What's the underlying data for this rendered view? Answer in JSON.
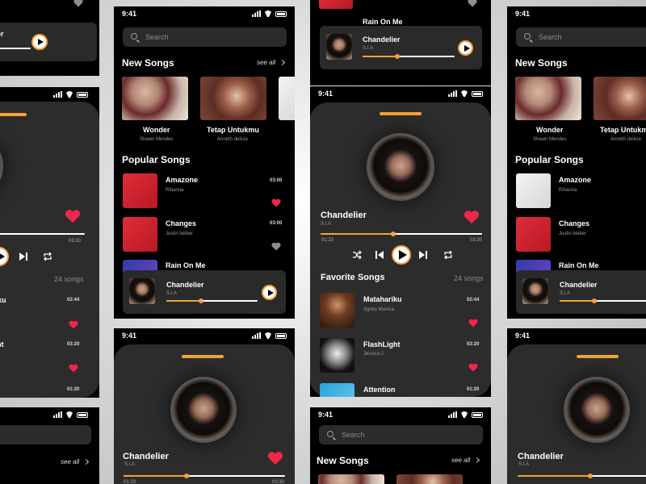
{
  "status": {
    "time": "9:41"
  },
  "search": {
    "placeholder": "Search"
  },
  "sections": {
    "new_songs": "New Songs",
    "popular_songs": "Popular Songs",
    "favorite_songs": "Favorite Songs",
    "see_all": "see all"
  },
  "new_songs": [
    {
      "title": "Wonder",
      "artist": "Shawn Mendes"
    },
    {
      "title": "Tetap Untukmu",
      "artist": "Anneth delicia"
    }
  ],
  "popular_songs": [
    {
      "title": "Amazone",
      "artist": "Rihanna",
      "duration": "03:00",
      "liked": true
    },
    {
      "title": "Changes",
      "artist": "Justin beiber",
      "duration": "03:00",
      "liked": false
    },
    {
      "title": "Rain On Me",
      "artist": "",
      "duration": "",
      "liked": false
    }
  ],
  "favorite_songs": {
    "count": "24 songs",
    "items": [
      {
        "title": "Matahariku",
        "artist": "Agnes Monica",
        "duration": "02:44"
      },
      {
        "title": "FlashLight",
        "artist": "Jessica J",
        "duration": "03:20"
      },
      {
        "title": "Attention",
        "artist": "",
        "duration": "01:20"
      }
    ]
  },
  "now_playing": {
    "title": "Chandelier",
    "artist": "S.I.A",
    "elapsed": "01:23",
    "total": "03:30",
    "progress": 0.39
  },
  "mini_player": {
    "title": "Chandelier",
    "artist": "S.I.A",
    "progress": 0.38
  },
  "left_fragments": {
    "ariku": "ariku",
    "ight": "ight",
    "t": "t",
    "d0244": "02:44",
    "d0320": "03:20",
    "d0120": "01:20",
    "count": "24 songs",
    "time": "03:30"
  },
  "icons": [
    "search-icon",
    "heart-icon",
    "play-icon",
    "shuffle-icon",
    "previous-icon",
    "next-icon",
    "repeat-icon",
    "chevron-right-icon",
    "signal-icon",
    "wifi-icon",
    "battery-icon"
  ],
  "colors": {
    "accent": "#F2A23A",
    "heart": "#F0264A",
    "card": "#2C2C2C",
    "screen": "#000000"
  }
}
